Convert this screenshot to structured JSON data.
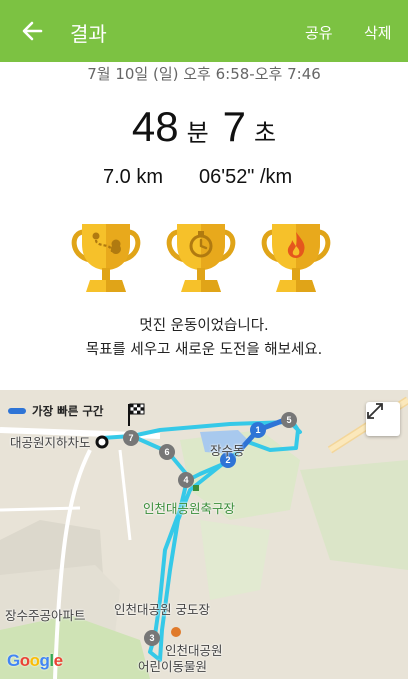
{
  "appbar": {
    "title": "결과",
    "back_icon": "back-arrow-icon",
    "share_label": "공유",
    "delete_label": "삭제",
    "color": "#7cc242"
  },
  "summary": {
    "date": "7월 10일 (일) 오후 6:58-오후 7:46",
    "minutes": "48",
    "minutes_unit": "분",
    "seconds": "7",
    "seconds_unit": "초",
    "distance": "7.0 km",
    "pace": "06'52\" /km"
  },
  "trophies": [
    {
      "icon": "route-trophy-icon"
    },
    {
      "icon": "stopwatch-trophy-icon"
    },
    {
      "icon": "flame-trophy-icon"
    }
  ],
  "message": {
    "line1": "멋진 운동이었습니다.",
    "line2": "목표를 세우고 새로운 도전을 해보세요."
  },
  "map": {
    "legend_label": "가장 빠른 구간",
    "legend_color": "#2e74d6",
    "route_color": "#33c8e6",
    "labels": {
      "station": "대공원지하차도",
      "pond": "장수동",
      "stadium": "인천대공원축구장",
      "apartment": "장수주공아파트",
      "archery": "인천대공원 궁도장",
      "zoo1": "인천대공원",
      "zoo2": "어린이동물원"
    },
    "markers": [
      "1",
      "2",
      "3",
      "4",
      "5",
      "6",
      "7"
    ],
    "attribution": "Google"
  }
}
